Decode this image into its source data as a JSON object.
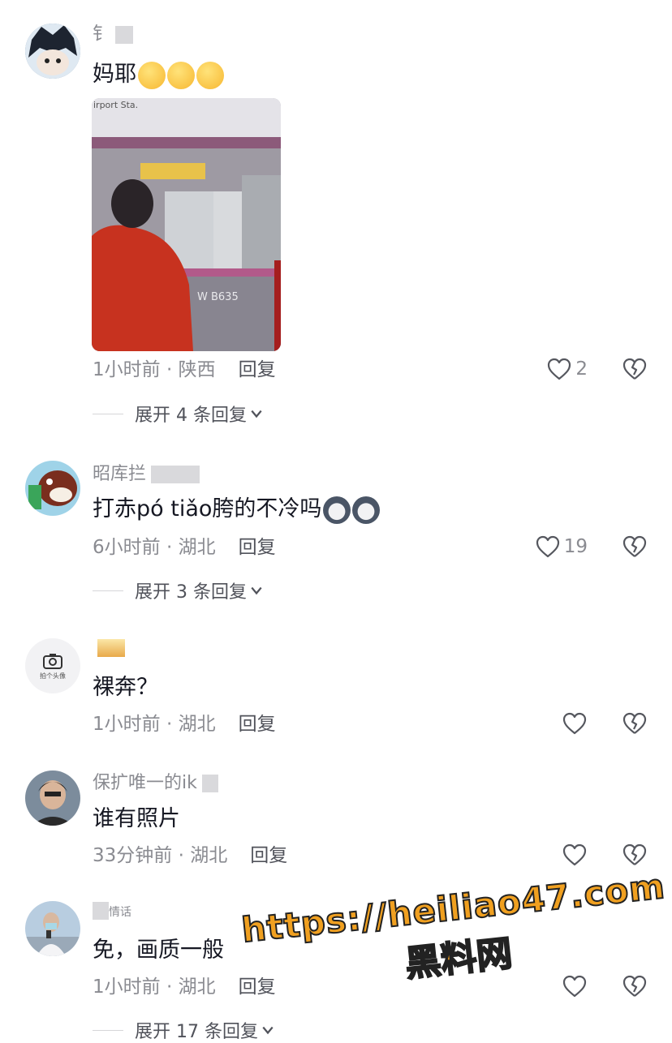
{
  "comments": [
    {
      "username": "钅",
      "text": "妈耶",
      "time": "1小时前 · 陕西",
      "reply": "回复",
      "likes": "2",
      "expand": "展开 4 条回复"
    },
    {
      "username": "昭库拦",
      "text": "打赤pó tiǎo胯的不冷吗",
      "time": "6小时前 · 湖北",
      "reply": "回复",
      "likes": "19",
      "expand": "展开 3 条回复"
    },
    {
      "username": "",
      "avatar_label": "拍个头像",
      "text": "裸奔？",
      "time": "1小时前 · 湖北",
      "reply": "回复",
      "likes": ""
    },
    {
      "username": "保扩唯一的ik",
      "text": "谁有照片",
      "time": "33分钟前 · 湖北",
      "reply": "回复",
      "likes": ""
    },
    {
      "username": "情话",
      "text": "免，画质一般",
      "time": "1小时前 · 湖北",
      "reply": "回复",
      "likes": "",
      "expand": "展开 17 条回复"
    }
  ],
  "photo": {
    "sign_text": "irport Sta.",
    "train_number": "W B635"
  },
  "watermark": {
    "line1": "https://heiliao47.com",
    "line2": "黑料网"
  },
  "icons": {
    "like": "heart-outline-icon",
    "dislike": "broken-heart-icon",
    "expand": "chevron-down-icon",
    "camera": "camera-icon"
  }
}
